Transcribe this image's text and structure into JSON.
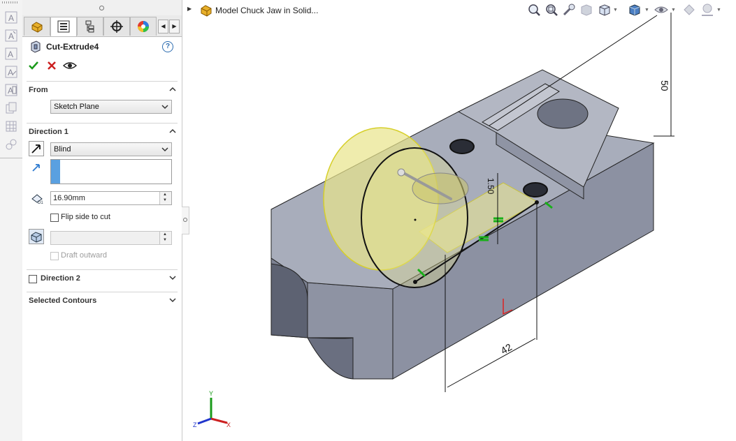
{
  "left_toolbar": {
    "icons": [
      "text-a-icon",
      "text-a-alt-icon",
      "text-style-icon",
      "text-format-icon",
      "text-box-icon",
      "copy-icon",
      "grid-icon",
      "link-icon"
    ]
  },
  "manager_tabs": [
    {
      "name": "feature-manager-tab",
      "icon": "feature-tree-icon"
    },
    {
      "name": "property-manager-tab",
      "icon": "property-list-icon"
    },
    {
      "name": "configuration-manager-tab",
      "icon": "configuration-icon"
    },
    {
      "name": "dimxpert-manager-tab",
      "icon": "crosshair-icon"
    },
    {
      "name": "display-manager-tab",
      "icon": "color-wheel-icon"
    }
  ],
  "property_manager": {
    "title": "Cut-Extrude4",
    "help": "?",
    "from": {
      "header": "From",
      "start_condition": "Sketch Plane"
    },
    "direction1": {
      "header": "Direction 1",
      "end_condition": "Blind",
      "depth": "16.90mm",
      "flip_side_label": "Flip side to cut",
      "flip_side_checked": false,
      "draft_angle": "",
      "draft_outward_label": "Draft outward"
    },
    "direction2": {
      "header": "Direction 2",
      "checked": false
    },
    "selected_contours": {
      "header": "Selected Contours"
    }
  },
  "breadcrumb": {
    "text": "Model Chuck Jaw in Solid..."
  },
  "dimensions": {
    "width": "42",
    "height": "50",
    "depth_small": "1.50"
  },
  "triad": {
    "x": "X",
    "y": "Y",
    "z": "Z"
  },
  "colors": {
    "part_face_top": "#a8adbb",
    "part_face_front": "#8e93a3",
    "part_face_side": "#7d8293",
    "preview_yellow": "#ece98f",
    "accept_green": "#1a9a1a",
    "cancel_red": "#cc2020"
  }
}
